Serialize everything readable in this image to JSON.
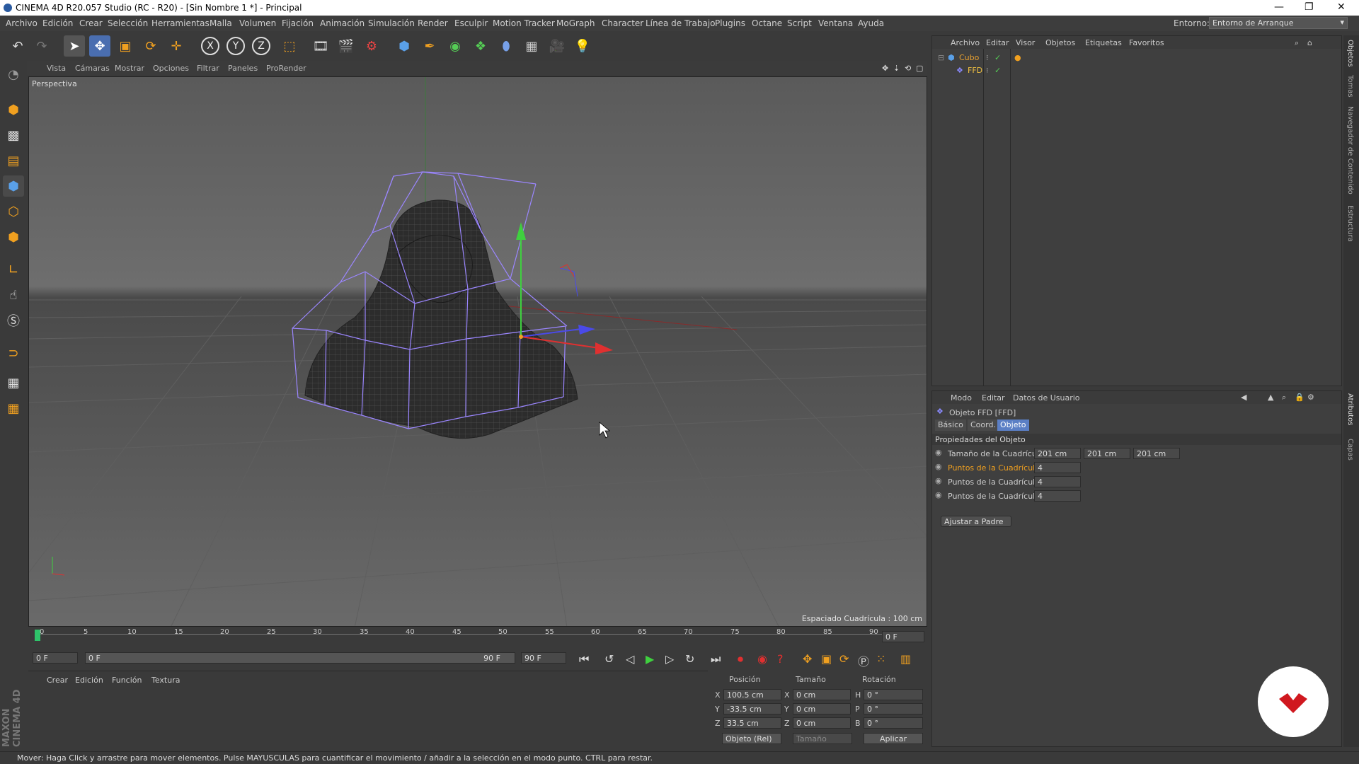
{
  "window": {
    "title": "CINEMA 4D R20.057 Studio (RC - R20) - [Sin Nombre 1 *] - Principal",
    "minimize": "—",
    "restore": "❐",
    "close": "✕"
  },
  "menu": {
    "items": [
      "Archivo",
      "Edición",
      "Crear",
      "Selección",
      "Herramientas",
      "Malla",
      "Volumen",
      "Fijación",
      "Animación",
      "Simulación",
      "Render",
      "Esculpir",
      "Motion Tracker",
      "MoGraph",
      "Character",
      "Línea de Trabajo",
      "Plugins",
      "Octane",
      "Script",
      "Ventana",
      "Ayuda"
    ],
    "environment_label": "Entorno:",
    "environment_value": "Entorno de Arranque"
  },
  "viewport": {
    "menu": [
      "Vista",
      "Cámaras",
      "Mostrar",
      "Opciones",
      "Filtrar",
      "Paneles",
      "ProRender"
    ],
    "camera_label": "Perspectiva",
    "grid_spacing": "Espaciado Cuadrícula : 100 cm"
  },
  "timeline": {
    "ticks": [
      "0",
      "5",
      "10",
      "15",
      "20",
      "25",
      "30",
      "35",
      "40",
      "45",
      "50",
      "55",
      "60",
      "65",
      "70",
      "75",
      "80",
      "85",
      "90"
    ],
    "current_frame_right": "0 F",
    "start_field": "0 F",
    "range_start": "0 F",
    "range_end": "90 F",
    "end_field": "90 F"
  },
  "material_panel": {
    "menu": [
      "Crear",
      "Edición",
      "Función",
      "Textura"
    ]
  },
  "coords": {
    "headers": [
      "Posición",
      "Tamaño",
      "Rotación"
    ],
    "rows": [
      {
        "axis": "X",
        "pos": "100.5 cm",
        "size_axis": "X",
        "size": "0 cm",
        "rot_axis": "H",
        "rot": "0 °"
      },
      {
        "axis": "Y",
        "pos": "-33.5 cm",
        "size_axis": "Y",
        "size": "0 cm",
        "rot_axis": "P",
        "rot": "0 °"
      },
      {
        "axis": "Z",
        "pos": "33.5 cm",
        "size_axis": "Z",
        "size": "0 cm",
        "rot_axis": "B",
        "rot": "0 °"
      }
    ],
    "mode": "Objeto (Rel)",
    "size_mode": "Tamaño",
    "apply": "Aplicar"
  },
  "object_manager": {
    "menu": [
      "Archivo",
      "Editar",
      "Visor",
      "Objetos",
      "Etiquetas",
      "Favoritos"
    ],
    "objects": [
      {
        "name": "Cubo",
        "color": "#e8a030"
      },
      {
        "name": "FFD",
        "color": "#f0c040"
      }
    ]
  },
  "attributes": {
    "menu": [
      "Modo",
      "Editar",
      "Datos de Usuario"
    ],
    "object_title": "Objeto FFD [FFD]",
    "tabs": [
      "Básico",
      "Coord.",
      "Objeto"
    ],
    "section": "Propiedades del Objeto",
    "rows": [
      {
        "label": "Tamaño de la Cuadrícula . . .",
        "v1": "201 cm",
        "v2": "201 cm",
        "v3": "201 cm"
      },
      {
        "label": "Puntos de la Cuadrícula en X",
        "v1": "4"
      },
      {
        "label": "Puntos de la Cuadrícula en Y",
        "v1": "4"
      },
      {
        "label": "Puntos de la Cuadrícula en Z",
        "v1": "4"
      }
    ],
    "fit_button": "Ajustar a Padre"
  },
  "side_tabs": [
    "Objetos",
    "Tomas",
    "Navegador de Contenido",
    "Estructura",
    "Atributos",
    "Capas"
  ],
  "brand_side": "MAXON CINEMA 4D",
  "status": "Mover: Haga Click y arrastre para mover elementos. Pulse MAYUSCULAS para cuantificar el movimiento / añadir a la selección en el modo punto. CTRL para restar.",
  "colors": {
    "accent": "#5b7fc5",
    "highlight": "#f0a020"
  }
}
